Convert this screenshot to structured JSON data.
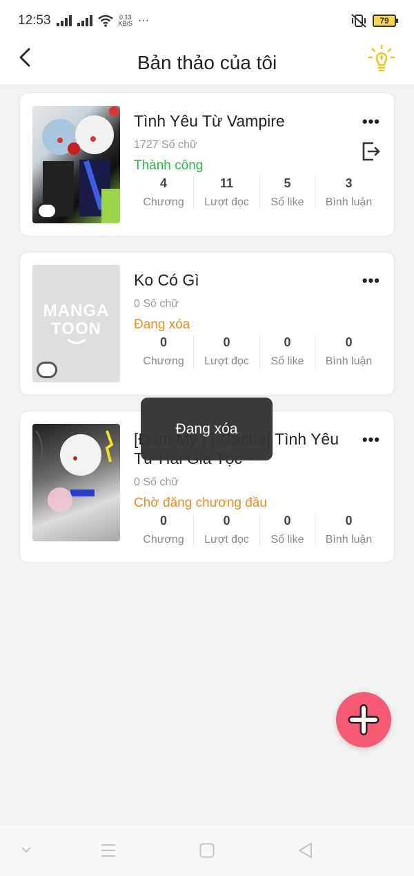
{
  "status_bar": {
    "time": "12:53",
    "net_speed_value": "0.13",
    "net_speed_unit": "KB/S",
    "more": "···",
    "battery": "79"
  },
  "header": {
    "title": "Bản thảo của tôi"
  },
  "stat_labels": {
    "chapters": "Chương",
    "reads": "Lượt đọc",
    "likes": "Số like",
    "comments": "Bình luận"
  },
  "drafts": [
    {
      "title": "Tình Yêu Từ Vampire",
      "word_count": "1727 Số chữ",
      "status": "Thành công",
      "status_color": "#2db84c",
      "chapters": "4",
      "reads": "11",
      "likes": "5",
      "comments": "3"
    },
    {
      "title": "Ko Có Gì",
      "word_count": "0 Số chữ",
      "status": "Đang xóa",
      "status_color": "#f08c1c",
      "placeholder_logo_line1": "MANGA",
      "placeholder_logo_line2": "TOON",
      "chapters": "0",
      "reads": "0",
      "likes": "0",
      "comments": "0"
    },
    {
      "title": "[Đam Mỹ ] [ Gacha] Tình Yêu Từ Hai Gia Tộc ~",
      "word_count": "0 Số chữ",
      "status": "Chờ đăng chương đầu",
      "status_color": "#f08c1c",
      "chapters": "0",
      "reads": "0",
      "likes": "0",
      "comments": "0"
    }
  ],
  "more_label": "•••",
  "toast": "Đang xóa",
  "colors": {
    "accent": "#f45a73",
    "bulb": "#f5c518"
  }
}
